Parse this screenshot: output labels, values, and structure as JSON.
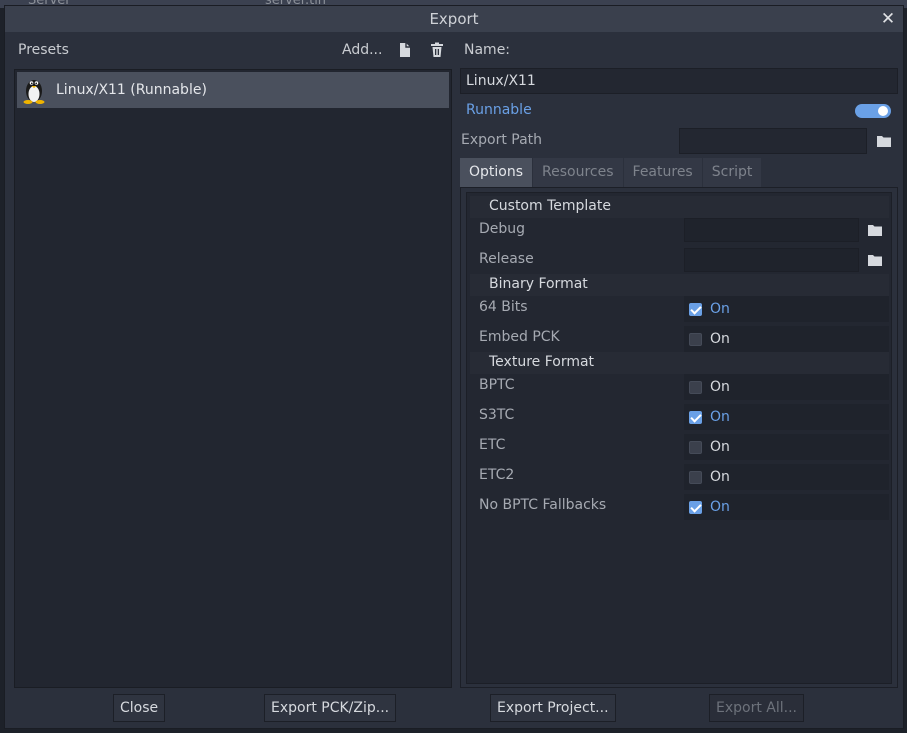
{
  "background": {
    "tab_left": "Server",
    "tab_right": "server.tin"
  },
  "dialog": {
    "title": "Export",
    "presets_label": "Presets",
    "add_label": "Add...",
    "presets": [
      {
        "label": "Linux/X11 (Runnable)",
        "icon": "linux-tux-icon"
      }
    ],
    "name_label": "Name:",
    "name_value": "Linux/X11",
    "runnable_label": "Runnable",
    "runnable_on": true,
    "export_path_label": "Export Path",
    "export_path_value": "",
    "tabs": [
      "Options",
      "Resources",
      "Features",
      "Script"
    ],
    "active_tab": "Options",
    "options": {
      "custom_template": {
        "header": "Custom Template",
        "debug_label": "Debug",
        "debug_value": "",
        "release_label": "Release",
        "release_value": ""
      },
      "binary_format": {
        "header": "Binary Format",
        "bits64_label": "64 Bits",
        "bits64_text": "On",
        "bits64_checked": true,
        "embed_pck_label": "Embed PCK",
        "embed_pck_text": "On",
        "embed_pck_checked": false
      },
      "texture_format": {
        "header": "Texture Format",
        "bptc_label": "BPTC",
        "bptc_text": "On",
        "bptc_checked": false,
        "s3tc_label": "S3TC",
        "s3tc_text": "On",
        "s3tc_checked": true,
        "etc_label": "ETC",
        "etc_text": "On",
        "etc_checked": false,
        "etc2_label": "ETC2",
        "etc2_text": "On",
        "etc2_checked": false,
        "no_bptc_label": "No BPTC Fallbacks",
        "no_bptc_text": "On",
        "no_bptc_checked": true
      }
    },
    "buttons": {
      "close": "Close",
      "export_pck": "Export PCK/Zip...",
      "export_project": "Export Project...",
      "export_all": "Export All..."
    }
  },
  "colors": {
    "accent": "#6aa0e6",
    "panel": "#2b303c",
    "field": "#232731"
  }
}
